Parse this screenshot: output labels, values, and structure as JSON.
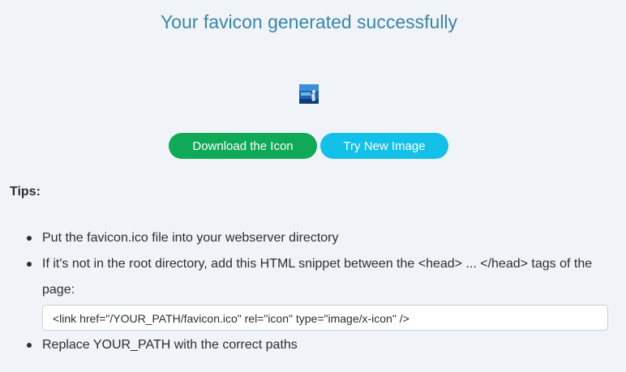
{
  "header": {
    "title": "Your favicon generated successfully"
  },
  "preview": {
    "icon": "generated-favicon-thumbnail"
  },
  "actions": {
    "download_label": "Download the Icon",
    "try_new_label": "Try New Image",
    "download_color": "#10a957",
    "try_new_color": "#12c0ea"
  },
  "tips": {
    "heading": "Tips:",
    "items": [
      "Put the favicon.ico file into your webserver directory",
      "If it's not in the root directory, add this HTML snippet between the <head> ... </head> tags of the page:",
      "Replace YOUR_PATH with the correct paths"
    ],
    "snippet": "<link href=\"/YOUR_PATH/favicon.ico\" rel=\"icon\" type=\"image/x-icon\" />"
  },
  "colors": {
    "title": "#3a86a8",
    "background": "#f0f4f8"
  }
}
